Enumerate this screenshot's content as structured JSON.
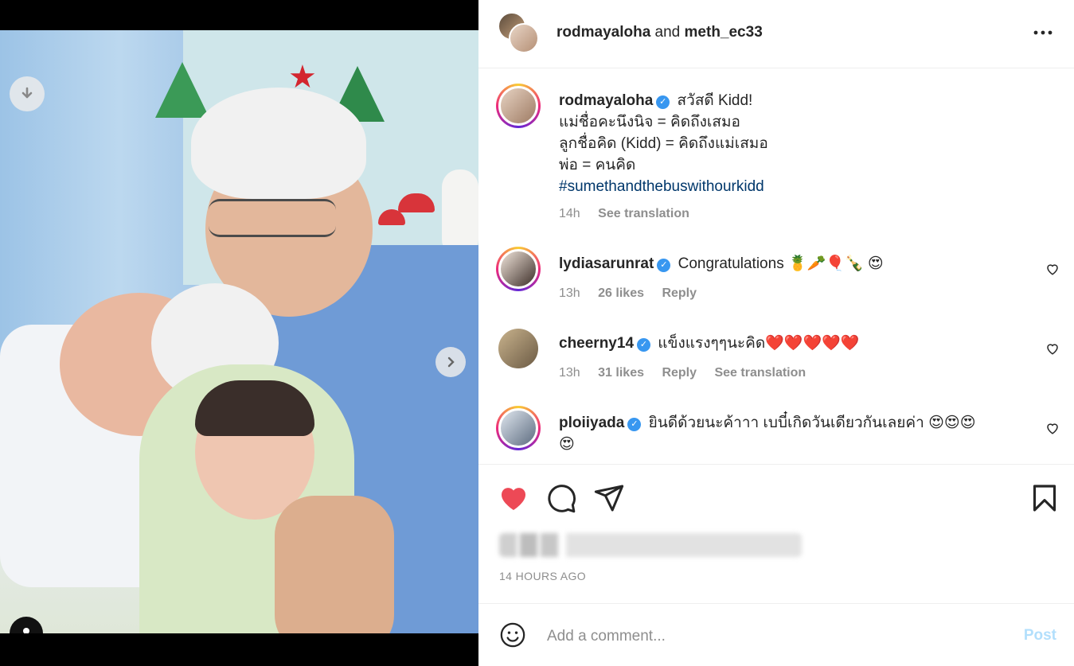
{
  "header": {
    "user1": "rodmayaloha",
    "conjunction": "and",
    "user2": "meth_ec33",
    "more_icon": "more-horizontal-icon"
  },
  "caption": {
    "username": "rodmayaloha",
    "lines": [
      "สวัสดี Kidd!",
      "แม่ชื่อคะนึงนิจ = คิดถึงเสมอ",
      "ลูกชื่อคิด (Kidd) = คิดถึงแม่เสมอ",
      "พ่อ = คนคิด"
    ],
    "hashtag": "#sumethandthebuswithourkidd",
    "time": "14h",
    "see_translation": "See translation"
  },
  "comments": [
    {
      "username": "lydiasarunrat",
      "text": "Congratulations 🍍🥕🎈🍾 😍",
      "time": "13h",
      "likes": "26 likes",
      "reply": "Reply"
    },
    {
      "username": "cheerny14",
      "text": "แข็งแรงๆๆนะคิด❤️❤️❤️❤️❤️",
      "time": "13h",
      "likes": "31 likes",
      "reply": "Reply",
      "see_translation": "See translation"
    },
    {
      "username": "ploiiyada",
      "text": "ยินดีด้วยนะค้าาา เบบี๋เกิดวันเดียวกันเลยค่า 😍😍😍",
      "text_line2": "😍"
    }
  ],
  "post": {
    "timestamp": "14 HOURS AGO",
    "liked": true,
    "like_color": "#ed4956"
  },
  "comment_bar": {
    "placeholder": "Add a comment...",
    "post_label": "Post"
  },
  "media": {
    "carousel_total": 2,
    "carousel_active": 1
  }
}
